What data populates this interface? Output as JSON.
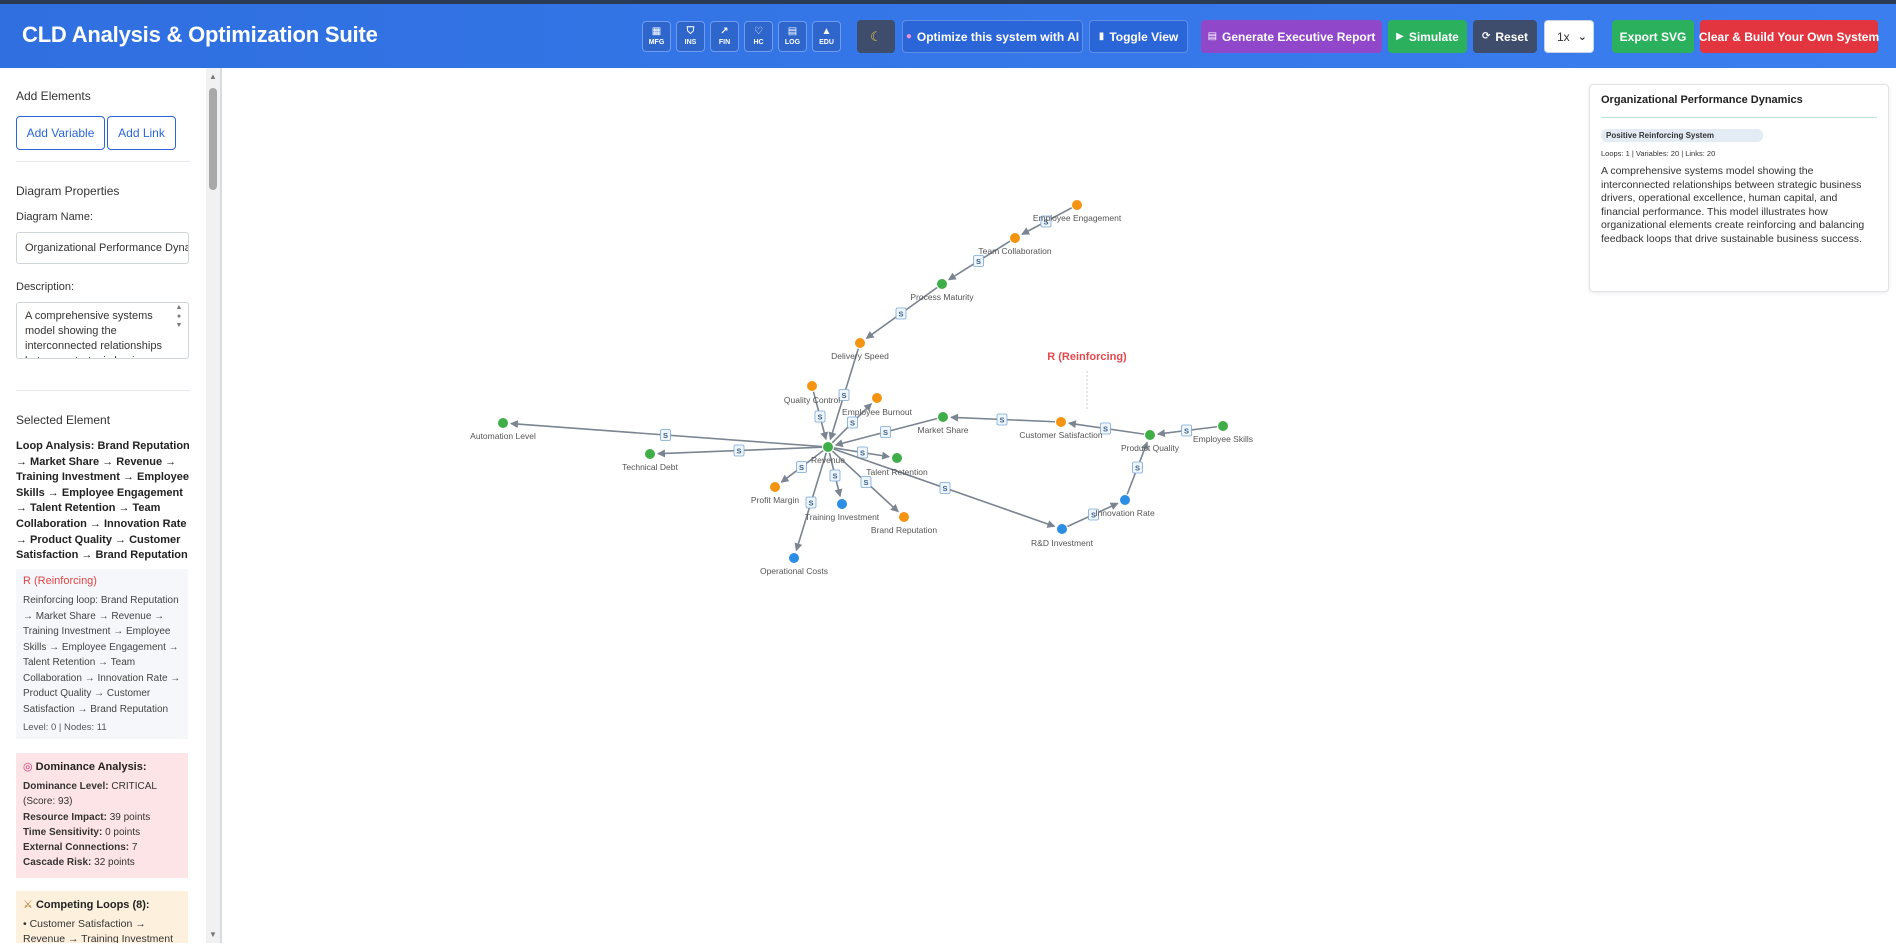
{
  "app": {
    "title": "CLD Analysis & Optimization Suite"
  },
  "industries": [
    {
      "icon": "factory-icon",
      "glyph": "▦",
      "label": "MFG"
    },
    {
      "icon": "shield-icon",
      "glyph": "⛉",
      "label": "INS"
    },
    {
      "icon": "line-chart-icon",
      "glyph": "↗",
      "label": "FIN"
    },
    {
      "icon": "heart-icon",
      "glyph": "♡",
      "label": "HC"
    },
    {
      "icon": "truck-icon",
      "glyph": "▤",
      "label": "LOG"
    },
    {
      "icon": "graduation-cap-icon",
      "glyph": "▲",
      "label": "EDU"
    }
  ],
  "toolbar": {
    "dark_mode_glyph": "☾",
    "optimize_label": "Optimize this system with AI",
    "toggle_view_label": "Toggle View",
    "executive_report_label": "Generate Executive Report",
    "simulate_label": "Simulate",
    "reset_label": "Reset",
    "speed_value": "1x",
    "export_svg_label": "Export SVG",
    "clear_build_label": "Clear & Build Your Own System"
  },
  "sidebar": {
    "add_elements_title": "Add Elements",
    "add_variable_label": "Add Variable",
    "add_link_label": "Add Link",
    "diagram_properties_title": "Diagram Properties",
    "diagram_name_label": "Diagram Name:",
    "diagram_name_value": "Organizational Performance Dynamics",
    "description_label": "Description:",
    "description_value": "A comprehensive systems model showing the interconnected relationships between strategic business drivers",
    "selected_element_title": "Selected Element",
    "loop_analysis": "Loop Analysis: Brand Reputation → Market Share → Revenue → Training Investment → Employee Skills → Employee Engagement → Talent Retention → Team Collaboration → Innovation Rate → Product Quality → Customer Satisfaction → Brand Reputation",
    "loop_box": {
      "title": "R (Reinforcing)",
      "description": "Reinforcing loop: Brand Reputation → Market Share → Revenue → Training Investment → Employee Skills → Employee Engagement → Talent Retention → Team Collaboration → Innovation Rate → Product Quality → Customer Satisfaction → Brand Reputation",
      "meta": "Level: 0 | Nodes: 11"
    },
    "dominance": {
      "title": "Dominance Analysis:",
      "level_label": "Dominance Level:",
      "level_value": "CRITICAL (Score: 93)",
      "resource_label": "Resource Impact:",
      "resource_value": "39 points",
      "time_label": "Time Sensitivity:",
      "time_value": "0 points",
      "external_label": "External Connections:",
      "external_value": "7",
      "cascade_label": "Cascade Risk:",
      "cascade_value": "32 points"
    },
    "competing": {
      "title": "Competing Loops (8):",
      "first_item": "• Customer Satisfaction → Revenue → Training Investment"
    }
  },
  "info_panel": {
    "title": "Organizational Performance Dynamics",
    "badge": "Positive Reinforcing System",
    "meta": "Loops: 1 | Variables: 20 | Links: 20",
    "description": "A comprehensive systems model showing the interconnected relationships between strategic business drivers, operational excellence, human capital, and financial performance. This model illustrates how organizational elements create reinforcing and balancing feedback loops that drive sustainable business success."
  },
  "diagram": {
    "loop_label": "R (Reinforcing)",
    "link_polarity": "S",
    "node_colors": {
      "green": "#3fae49",
      "orange": "#f39512",
      "blue": "#2b8de3"
    },
    "nodes": [
      {
        "id": "employee_engagement",
        "label": "Employee Engagement",
        "color": "orange"
      },
      {
        "id": "team_collaboration",
        "label": "Team Collaboration",
        "color": "orange"
      },
      {
        "id": "process_maturity",
        "label": "Process Maturity",
        "color": "green"
      },
      {
        "id": "delivery_speed",
        "label": "Delivery Speed",
        "color": "orange"
      },
      {
        "id": "quality_control",
        "label": "Quality Control",
        "color": "orange"
      },
      {
        "id": "employee_burnout",
        "label": "Employee Burnout",
        "color": "orange"
      },
      {
        "id": "market_share",
        "label": "Market Share",
        "color": "green"
      },
      {
        "id": "customer_satisfaction",
        "label": "Customer Satisfaction",
        "color": "orange"
      },
      {
        "id": "product_quality",
        "label": "Product Quality",
        "color": "green"
      },
      {
        "id": "employee_skills",
        "label": "Employee Skills",
        "color": "green"
      },
      {
        "id": "automation_level",
        "label": "Automation Level",
        "color": "green"
      },
      {
        "id": "technical_debt",
        "label": "Technical Debt",
        "color": "green"
      },
      {
        "id": "revenue",
        "label": "Revenue",
        "color": "green"
      },
      {
        "id": "talent_retention",
        "label": "Talent Retention",
        "color": "green"
      },
      {
        "id": "profit_margin",
        "label": "Profit Margin",
        "color": "orange"
      },
      {
        "id": "training_investment",
        "label": "Training Investment",
        "color": "blue"
      },
      {
        "id": "brand_reputation",
        "label": "Brand Reputation",
        "color": "orange"
      },
      {
        "id": "rd_investment",
        "label": "R&D Investment",
        "color": "blue"
      },
      {
        "id": "innovation_rate",
        "label": "Innovation Rate",
        "color": "blue"
      },
      {
        "id": "operational_costs",
        "label": "Operational Costs",
        "color": "blue"
      }
    ],
    "links": [
      {
        "from": "employee_engagement",
        "to": "team_collaboration"
      },
      {
        "from": "team_collaboration",
        "to": "process_maturity"
      },
      {
        "from": "process_maturity",
        "to": "delivery_speed"
      },
      {
        "from": "delivery_speed",
        "to": "revenue"
      },
      {
        "from": "quality_control",
        "to": "revenue"
      },
      {
        "from": "revenue",
        "to": "employee_burnout"
      },
      {
        "from": "market_share",
        "to": "revenue"
      },
      {
        "from": "customer_satisfaction",
        "to": "market_share"
      },
      {
        "from": "product_quality",
        "to": "customer_satisfaction"
      },
      {
        "from": "employee_skills",
        "to": "product_quality"
      },
      {
        "from": "revenue",
        "to": "automation_level"
      },
      {
        "from": "revenue",
        "to": "technical_debt"
      },
      {
        "from": "revenue",
        "to": "talent_retention"
      },
      {
        "from": "revenue",
        "to": "profit_margin"
      },
      {
        "from": "revenue",
        "to": "training_investment"
      },
      {
        "from": "revenue",
        "to": "brand_reputation"
      },
      {
        "from": "revenue",
        "to": "operational_costs"
      },
      {
        "from": "revenue",
        "to": "rd_investment"
      },
      {
        "from": "rd_investment",
        "to": "innovation_rate"
      },
      {
        "from": "innovation_rate",
        "to": "product_quality"
      }
    ]
  }
}
